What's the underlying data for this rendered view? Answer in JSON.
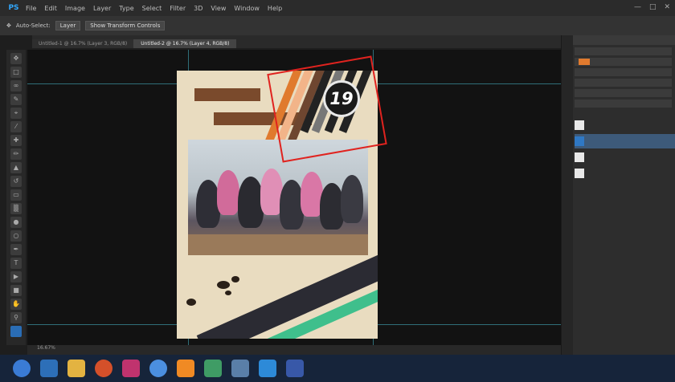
{
  "app": {
    "logo": "PS"
  },
  "menus": [
    "File",
    "Edit",
    "Image",
    "Layer",
    "Type",
    "Select",
    "Filter",
    "3D",
    "View",
    "Window",
    "Help"
  ],
  "window_controls": [
    "minimize-icon",
    "maximize-icon",
    "close-icon"
  ],
  "options": [
    "Auto-Select:",
    "Layer",
    "Show Transform Controls"
  ],
  "tabs": [
    {
      "label": "Untitled-1 @ 16.7% (Layer 3, RGB/8)",
      "active": false
    },
    {
      "label": "Untitled-2 @ 16.7% (Layer 4, RGB/8)",
      "active": true
    }
  ],
  "tools": [
    "move",
    "marquee",
    "lasso",
    "quick-select",
    "crop",
    "eyedropper",
    "heal",
    "brush",
    "stamp",
    "history",
    "eraser",
    "gradient",
    "blur",
    "dodge",
    "pen",
    "type",
    "path-select",
    "shape",
    "hand",
    "zoom",
    "fg-bg"
  ],
  "poster": {
    "title_1": "",
    "title_2": "",
    "badge": "19",
    "band_text": "",
    "band_sub": ""
  },
  "status": {
    "zoom": "16.67%"
  },
  "right_panel": {
    "header": "",
    "rows": [
      "",
      "",
      "",
      "",
      "",
      ""
    ],
    "layers": [
      {
        "name": "",
        "thumb": "white",
        "selected": false
      },
      {
        "name": "",
        "thumb": "blue",
        "selected": true
      },
      {
        "name": "",
        "thumb": "white",
        "selected": false
      },
      {
        "name": "",
        "thumb": "white",
        "selected": false
      }
    ]
  },
  "taskbar": {
    "apps": [
      "ie-icon",
      "folder-icon",
      "media-icon",
      "firefox-icon",
      "mail-icon",
      "chrome-icon",
      "ps-icon",
      "explorer-icon",
      "photos-icon",
      "word-icon"
    ],
    "time": "",
    "date": ""
  },
  "colors": {
    "accent_red": "#e0231f",
    "green": "#3fbf8c",
    "brown": "#7a4a2c"
  }
}
